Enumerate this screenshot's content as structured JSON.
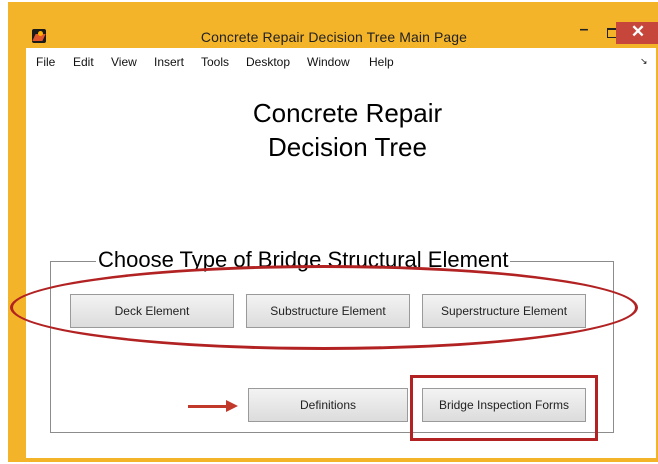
{
  "window": {
    "title": "Concrete Repair Decision Tree Main Page",
    "minimize_label": "–",
    "close_label": "✕"
  },
  "menu": {
    "items": [
      "File",
      "Edit",
      "View",
      "Insert",
      "Tools",
      "Desktop",
      "Window",
      "Help"
    ],
    "overflow_glyph": "↘"
  },
  "main": {
    "title_line1": "Concrete Repair",
    "title_line2": "Decision Tree"
  },
  "panel": {
    "legend": "Choose Type of Bridge Structural Element",
    "buttons": {
      "deck": "Deck Element",
      "substructure": "Substructure Element",
      "superstructure": "Superstructure Element",
      "definitions": "Definitions",
      "inspection_forms": "Bridge Inspection Forms"
    }
  },
  "colors": {
    "frame": "#f4b42a",
    "close_button": "#c7463c",
    "annotation": "#b22222"
  }
}
